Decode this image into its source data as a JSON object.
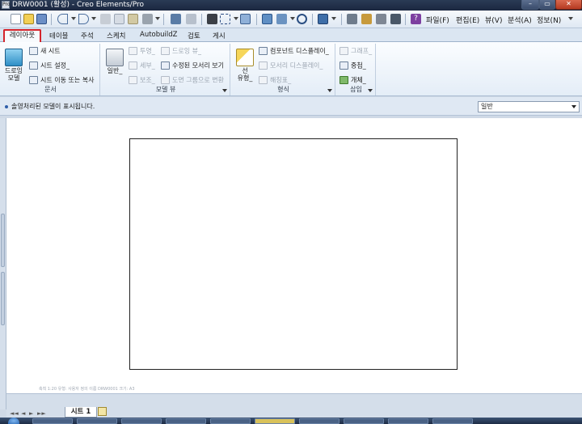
{
  "window": {
    "title": "DRW0001 (활성) - Creo Elements/Pro",
    "app_icon_text": "Pro",
    "minimize": "–",
    "maximize": "▭",
    "close": "✕"
  },
  "menubar": {
    "items": [
      "파일(F)",
      "편집(E)",
      "뷰(V)",
      "분석(A)",
      "정보(N)"
    ]
  },
  "tabs": [
    "레이아웃",
    "테이블",
    "주석",
    "스케치",
    "AutobuildZ",
    "검토",
    "게시"
  ],
  "ribbon": {
    "doc_group": {
      "label": "문서",
      "big_button": "드로잉\n모델",
      "items": [
        "새 시트",
        "시트 설정_",
        "시트 이동 또는 복사"
      ]
    },
    "model_view_group": {
      "label": "모델 뷰",
      "big_button": "일반_",
      "col1": [
        "투영_",
        "세부_",
        "보조_"
      ],
      "col2": [
        "드로잉 뷰_",
        "수정된 모서리 보기",
        "도면 그룹으로 변환"
      ]
    },
    "format_group": {
      "label": "형식",
      "big_button": "선\n유형_",
      "items": [
        "컴포넌트 디스플레이_",
        "모서리 디스플레이_",
        "해칭표_"
      ]
    },
    "insert_group": {
      "label": "삽입",
      "items": [
        "그래프_",
        "중첩_",
        "개체_"
      ]
    }
  },
  "info": {
    "message": "솔영처리된 모델이 표시됩니다.",
    "filter_value": "일반"
  },
  "canvas": {
    "faint_hint": "축척 1:20 유형: 사용자 정의  이름  DRW0001  크기: A3"
  },
  "sheetbar": {
    "nav": [
      "◄◄",
      "◄",
      "►",
      "►►"
    ],
    "sheet_tab": "시트 1"
  },
  "colors": {
    "title_bar": "#1b2740",
    "ribbon_bg": "#e4edf7",
    "active_tab_border": "#d4242c",
    "canvas": "#ffffff"
  }
}
